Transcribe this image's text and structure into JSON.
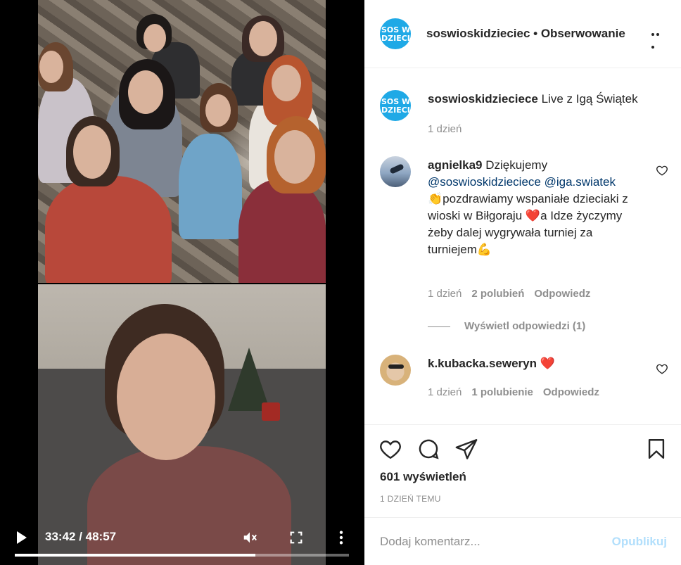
{
  "video": {
    "time": "33:42 / 48:57",
    "progress": 0.72,
    "play_icon": "play-icon",
    "mute_icon": "volume-muted-icon",
    "fullscreen_icon": "fullscreen-icon",
    "more_icon": "more-vertical-icon"
  },
  "header": {
    "avatar_text_line1": "SOS W",
    "avatar_text_line2": "DZIECI",
    "username": "soswioskidzieciec",
    "separator": " • ",
    "follow_label": "Obserwowanie",
    "more_icon": "more-horizontal-icon"
  },
  "caption": {
    "username": "soswioskidzieciece",
    "text": " Live z Igą Świątek",
    "time": "1 dzień"
  },
  "comments": [
    {
      "username": "agnielka9",
      "text_1": " Dziękujemy ",
      "mention_1": "@soswioskidzieciece",
      "mention_2": "@iga.swiatek",
      "text_2": " 👏pozdrawiamy wspaniałe dzieciaki z wioski w Biłgoraju ",
      "emoji_heart": "❤️",
      "text_3": "a Idze życzymy żeby dalej wygrywała turniej za turniejem",
      "emoji_muscle": "💪",
      "time": "1 dzień",
      "likes": "2 polubień",
      "reply": "Odpowiedz",
      "view_replies": "Wyświetl odpowiedzi (1)"
    },
    {
      "username": "k.kubacka.seweryn",
      "text": " ❤️",
      "time": "1 dzień",
      "likes": "1 polubienie",
      "reply": "Odpowiedz"
    }
  ],
  "actions": {
    "like_icon": "heart-icon",
    "comment_icon": "comment-icon",
    "share_icon": "share-icon",
    "save_icon": "bookmark-icon",
    "views": "601 wyświetleń",
    "posted": "1 DZIEŃ TEMU"
  },
  "add_comment": {
    "placeholder": "Dodaj komentarz...",
    "publish": "Opublikuj"
  },
  "colors": {
    "brand_blue": "#1fa9e6",
    "link": "#00376b",
    "muted": "#8e8e8e",
    "publish_disabled": "#b2dffc",
    "heart_red": "#ed4956"
  }
}
